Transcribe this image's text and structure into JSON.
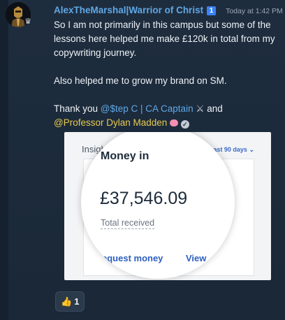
{
  "post": {
    "author": {
      "username": "AlexTheMarshal|Warrior of Christ",
      "rank_badge": "1",
      "avatar_icon": "helmeted-knight-avatar",
      "avatar_badge_icon": "crown-icon"
    },
    "timestamp": "Today at 1:42 PM",
    "message": {
      "paragraph_1": "So I am not primarily in this campus but some of the lessons here helped me make £120k in total from my copywriting journey.",
      "paragraph_2": "Also helped me to grow my brand on SM.",
      "thanks_prefix": "Thank you ",
      "mention_1": "@$tep C | CA Captain",
      "mention_1_icon": "crossed-swords-icon",
      "thanks_middle": " and",
      "mention_2": "@Professor Dylan Madden",
      "mention_2_icon": "brain-icon",
      "mention_2_verified_icon": "verified-badge-icon"
    },
    "attachment": {
      "insights_label": "Insights",
      "period_label": "Last 90 days",
      "money_title": "Money in",
      "amount": "£37,546.09",
      "amount_caption": "Total received",
      "request_money_link": "equest money",
      "view_link": "View"
    },
    "reaction": {
      "emoji_icon": "thumbs-up-icon",
      "count": "1"
    }
  },
  "colors": {
    "background": "#1e2d3e",
    "username": "#5fa8e6",
    "mention_step": "#5fa8e6",
    "mention_professor": "#e7c94f",
    "link_blue": "#2d5fbf"
  }
}
